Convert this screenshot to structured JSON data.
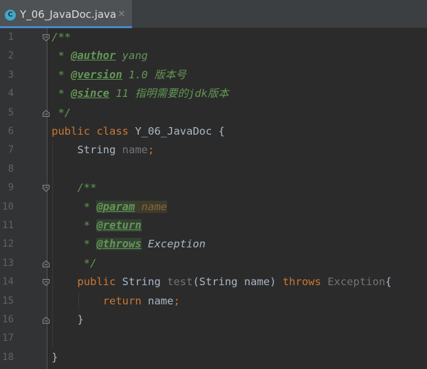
{
  "tab": {
    "icon_letter": "C",
    "filename": "Y_06_JavaDoc.java",
    "close": "×"
  },
  "lines": [
    {
      "n": "1",
      "fold": "open",
      "tokens": [
        [
          "doc",
          "/**"
        ]
      ]
    },
    {
      "n": "2",
      "fold": "",
      "tokens": [
        [
          "doc",
          " * "
        ],
        [
          "tag",
          "@author"
        ],
        [
          "doc",
          " yang"
        ]
      ]
    },
    {
      "n": "3",
      "fold": "",
      "tokens": [
        [
          "doc",
          " * "
        ],
        [
          "tag",
          "@version"
        ],
        [
          "doc",
          " 1.0 版本号"
        ]
      ]
    },
    {
      "n": "4",
      "fold": "",
      "tokens": [
        [
          "doc",
          " * "
        ],
        [
          "tag",
          "@since"
        ],
        [
          "doc",
          " 11 指明需要的jdk版本"
        ]
      ]
    },
    {
      "n": "5",
      "fold": "close",
      "tokens": [
        [
          "doc",
          " */"
        ]
      ]
    },
    {
      "n": "6",
      "fold": "",
      "tokens": [
        [
          "kw",
          "public class "
        ],
        [
          "plain",
          "Y_06_JavaDoc {"
        ]
      ]
    },
    {
      "n": "7",
      "fold": "",
      "tokens": [
        [
          "plain",
          "    String "
        ],
        [
          "gray",
          "name"
        ],
        [
          "punct",
          ";"
        ]
      ]
    },
    {
      "n": "8",
      "fold": "",
      "tokens": []
    },
    {
      "n": "9",
      "fold": "open",
      "tokens": [
        [
          "doc",
          "    /**"
        ]
      ]
    },
    {
      "n": "10",
      "fold": "",
      "tokens": [
        [
          "doc",
          "     * "
        ],
        [
          "tag hl",
          "@param"
        ],
        [
          "doc hl2",
          " "
        ],
        [
          "tagv hl2",
          "name"
        ]
      ]
    },
    {
      "n": "11",
      "fold": "",
      "tokens": [
        [
          "doc",
          "     * "
        ],
        [
          "tag hl",
          "@return"
        ]
      ]
    },
    {
      "n": "12",
      "fold": "",
      "tokens": [
        [
          "doc",
          "     * "
        ],
        [
          "tag hl",
          "@throws"
        ],
        [
          "plain italic",
          " Exception"
        ]
      ]
    },
    {
      "n": "13",
      "fold": "close",
      "tokens": [
        [
          "doc",
          "     */"
        ]
      ]
    },
    {
      "n": "14",
      "fold": "open",
      "tokens": [
        [
          "kw",
          "    public "
        ],
        [
          "plain",
          "String "
        ],
        [
          "gray",
          "test"
        ],
        [
          "plain",
          "(String name) "
        ],
        [
          "kw",
          "throws "
        ],
        [
          "gray",
          "Exception"
        ],
        [
          "plain",
          "{"
        ]
      ]
    },
    {
      "n": "15",
      "fold": "",
      "tokens": [
        [
          "kw",
          "        return "
        ],
        [
          "plain",
          "name"
        ],
        [
          "punct",
          ";"
        ]
      ]
    },
    {
      "n": "16",
      "fold": "close",
      "tokens": [
        [
          "plain",
          "    }"
        ]
      ]
    },
    {
      "n": "17",
      "fold": "",
      "tokens": []
    },
    {
      "n": "18",
      "fold": "",
      "tokens": [
        [
          "plain",
          "}"
        ]
      ]
    }
  ]
}
